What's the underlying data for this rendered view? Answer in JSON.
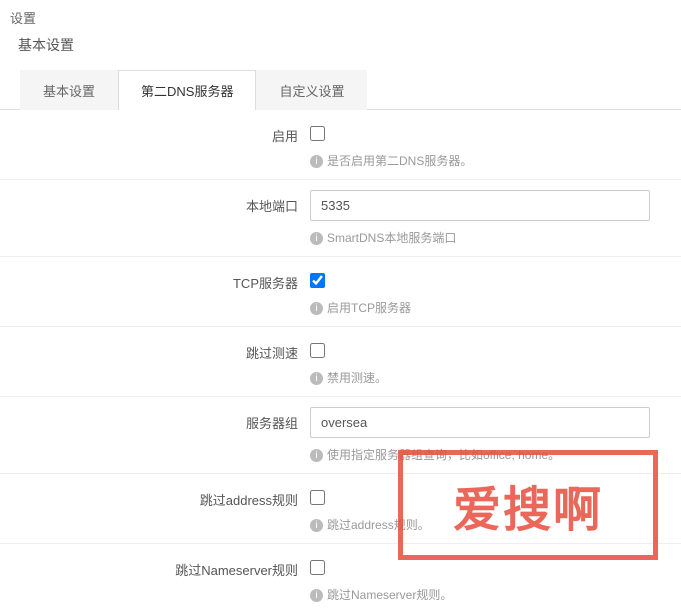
{
  "page_title": "设置",
  "section_title": "基本设置",
  "tabs": [
    {
      "label": "基本设置",
      "active": false
    },
    {
      "label": "第二DNS服务器",
      "active": true
    },
    {
      "label": "自定义设置",
      "active": false
    }
  ],
  "form": {
    "enable": {
      "label": "启用",
      "checked": false,
      "hint": "是否启用第二DNS服务器。"
    },
    "local_port": {
      "label": "本地端口",
      "value": "5335",
      "hint": "SmartDNS本地服务端口"
    },
    "tcp_server": {
      "label": "TCP服务器",
      "checked": true,
      "hint": "启用TCP服务器"
    },
    "skip_speed": {
      "label": "跳过测速",
      "checked": false,
      "hint": "禁用测速。"
    },
    "server_group": {
      "label": "服务器组",
      "value": "oversea",
      "hint": "使用指定服务器组查询，比如office, home。"
    },
    "skip_address": {
      "label": "跳过address规则",
      "checked": false,
      "hint": "跳过address规则。"
    },
    "skip_nameserver": {
      "label": "跳过Nameserver规则",
      "checked": false,
      "hint": "跳过Nameserver规则。"
    }
  },
  "watermark": "爱搜啊"
}
